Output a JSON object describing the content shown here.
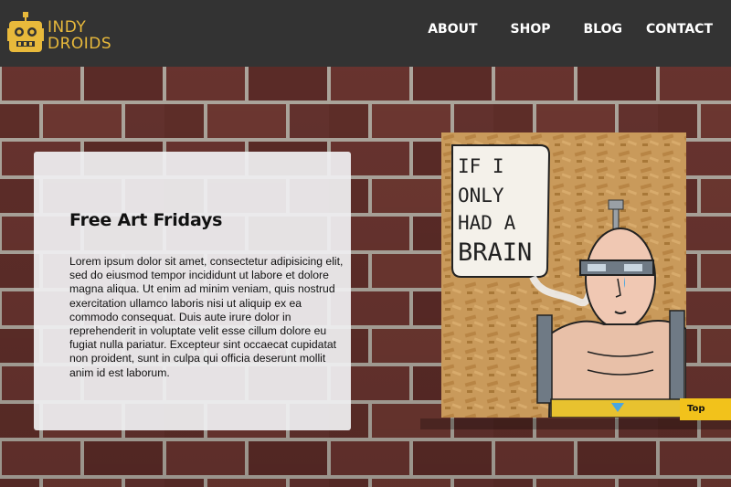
{
  "brand": {
    "line1": "INDY",
    "line2": "DROIDS",
    "accent": "#e8b93b"
  },
  "nav": {
    "items": [
      {
        "label": "ABOUT"
      },
      {
        "label": "SHOP"
      },
      {
        "label": "BLOG"
      },
      {
        "label": "CONTACT"
      }
    ]
  },
  "feature": {
    "title": "Free Art Fridays",
    "body": "Lorem ipsum dolor sit amet, consectetur adipisicing elit, sed do eiusmod tempor incididunt ut labore et dolore magna aliqua. Ut enim ad minim veniam, quis nostrud exercitation ullamco laboris nisi ut aliquip ex ea commodo consequat. Duis aute irure dolor in reprehenderit in voluptate velit esse cillum dolore eu fugiat nulla pariatur. Excepteur sint occaecat cupidatat non proident, sunt in culpa qui officia deserunt mollit anim id est laborum."
  },
  "artwork": {
    "speech_lines": [
      "IF I",
      "ONLY",
      "HAD A",
      "BRAIN"
    ]
  },
  "top_button": {
    "label": "Top",
    "color": "#f2c21b"
  },
  "colors": {
    "header_bg": "#333333",
    "brick": "#6b3530",
    "mortar": "#b9b2a8"
  }
}
